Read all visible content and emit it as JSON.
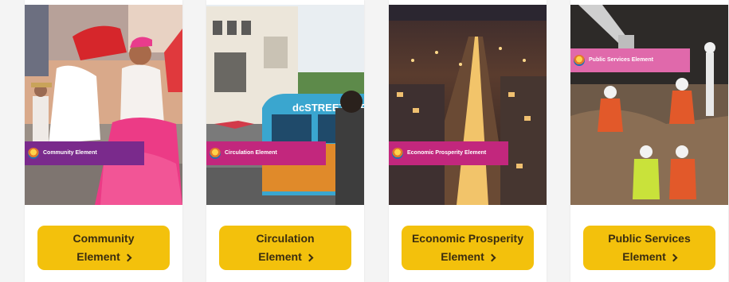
{
  "colors": {
    "button": "#f3c10c",
    "button_text": "#3a2d10",
    "band_purple": "#7a2a8c",
    "band_magenta": "#c2277d"
  },
  "cards": [
    {
      "cover_title": "Community Element",
      "button_line1": "Community",
      "button_line2": "Element",
      "button_icon": "chevron-right-icon"
    },
    {
      "cover_title": "Circulation Element",
      "button_line1": "Circulation",
      "button_line2": "Element",
      "button_icon": "chevron-right-icon"
    },
    {
      "cover_title": "Economic Prosperity Element",
      "button_line1": "Economic Prosperity",
      "button_line2": "Element",
      "button_icon": "chevron-right-icon"
    },
    {
      "cover_title": "Public Services Element",
      "button_line1": "Public Services",
      "button_line2": "Element",
      "button_icon": "chevron-right-icon"
    }
  ],
  "streetcar_text": "dcSTREETCAR"
}
